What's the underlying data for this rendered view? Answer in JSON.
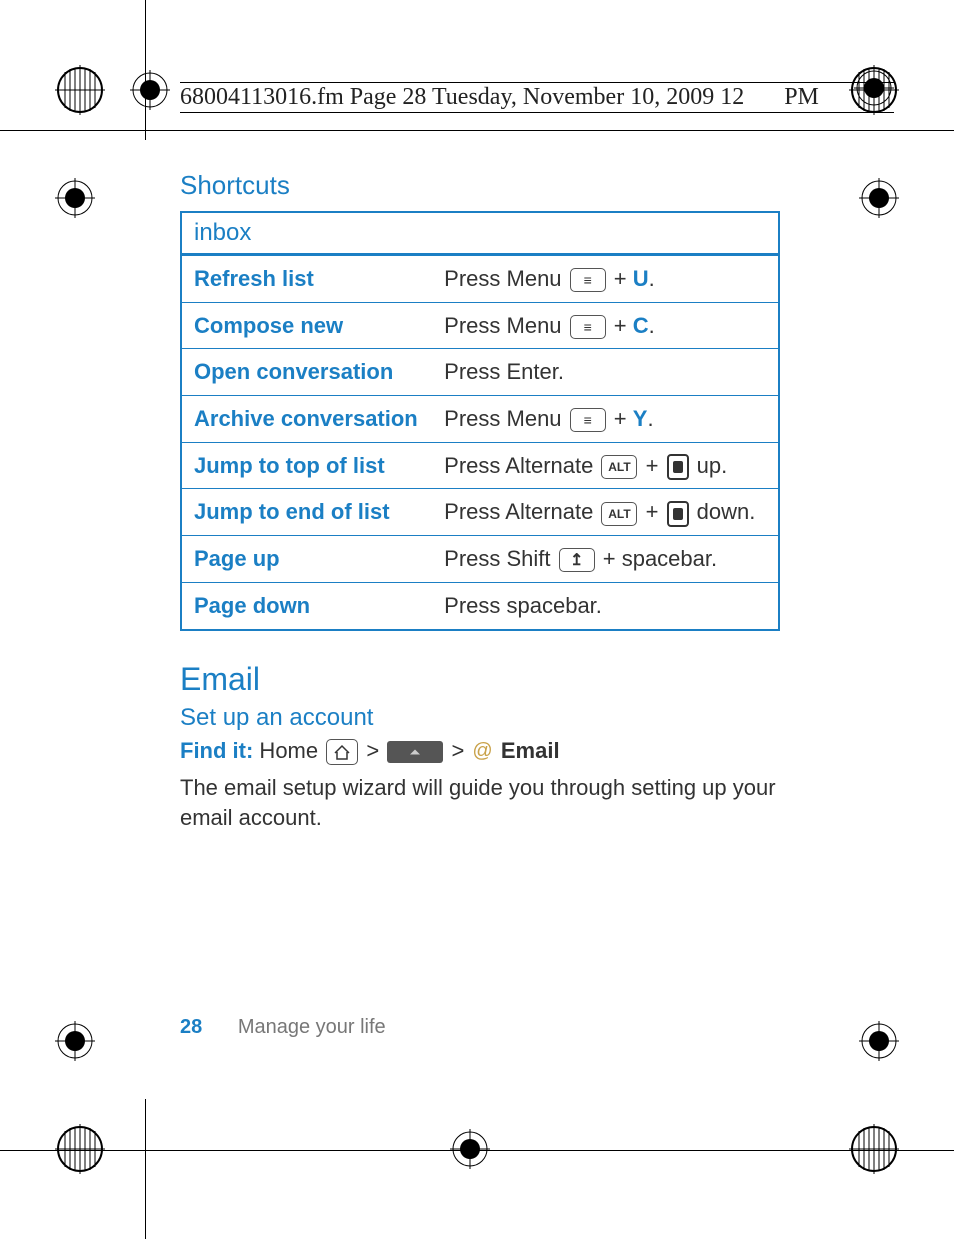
{
  "header_line": "68004113016.fm  Page 28  Tuesday, November 10, 2009  12",
  "header_line_suffix": " PM",
  "shortcuts_heading": "Shortcuts",
  "table_header": "inbox",
  "rows": [
    {
      "label": "Refresh list",
      "prefix": "Press Menu ",
      "icon": "menu",
      "plus": " + ",
      "letter": "U",
      "suffix": "."
    },
    {
      "label": "Compose new",
      "prefix": "Press Menu ",
      "icon": "menu",
      "plus": " + ",
      "letter": "C",
      "suffix": "."
    },
    {
      "label": "Open conversation",
      "prefix": "Press Enter.",
      "icon": "",
      "plus": "",
      "letter": "",
      "suffix": ""
    },
    {
      "label": "Archive conversation",
      "prefix": "Press Menu ",
      "icon": "menu",
      "plus": " + ",
      "letter": "Y",
      "suffix": "."
    },
    {
      "label": "Jump to top of list",
      "prefix": "Press Alternate ",
      "icon": "alt",
      "plus": " + ",
      "letter": "",
      "suffix": " up.",
      "nav": true
    },
    {
      "label": "Jump to end of list",
      "prefix": "Press Alternate ",
      "icon": "alt",
      "plus": "  + ",
      "letter": "",
      "suffix": " down.",
      "nav": true
    },
    {
      "label": "Page up",
      "prefix": "Press Shift ",
      "icon": "shift",
      "plus": " + spacebar.",
      "letter": "",
      "suffix": ""
    },
    {
      "label": "Page down",
      "prefix": "Press spacebar.",
      "icon": "",
      "plus": "",
      "letter": "",
      "suffix": ""
    }
  ],
  "email_heading": "Email",
  "setup_heading": "Set up an account",
  "findit_label": "Find it:",
  "findit_home": " Home ",
  "findit_gt1": " > ",
  "findit_gt2": " > ",
  "findit_email": " Email",
  "body_text": "The email setup wizard will guide you through setting up your email account.",
  "page_number": "28",
  "footer_text": "Manage your life",
  "icons": {
    "alt_label": "ALT"
  }
}
